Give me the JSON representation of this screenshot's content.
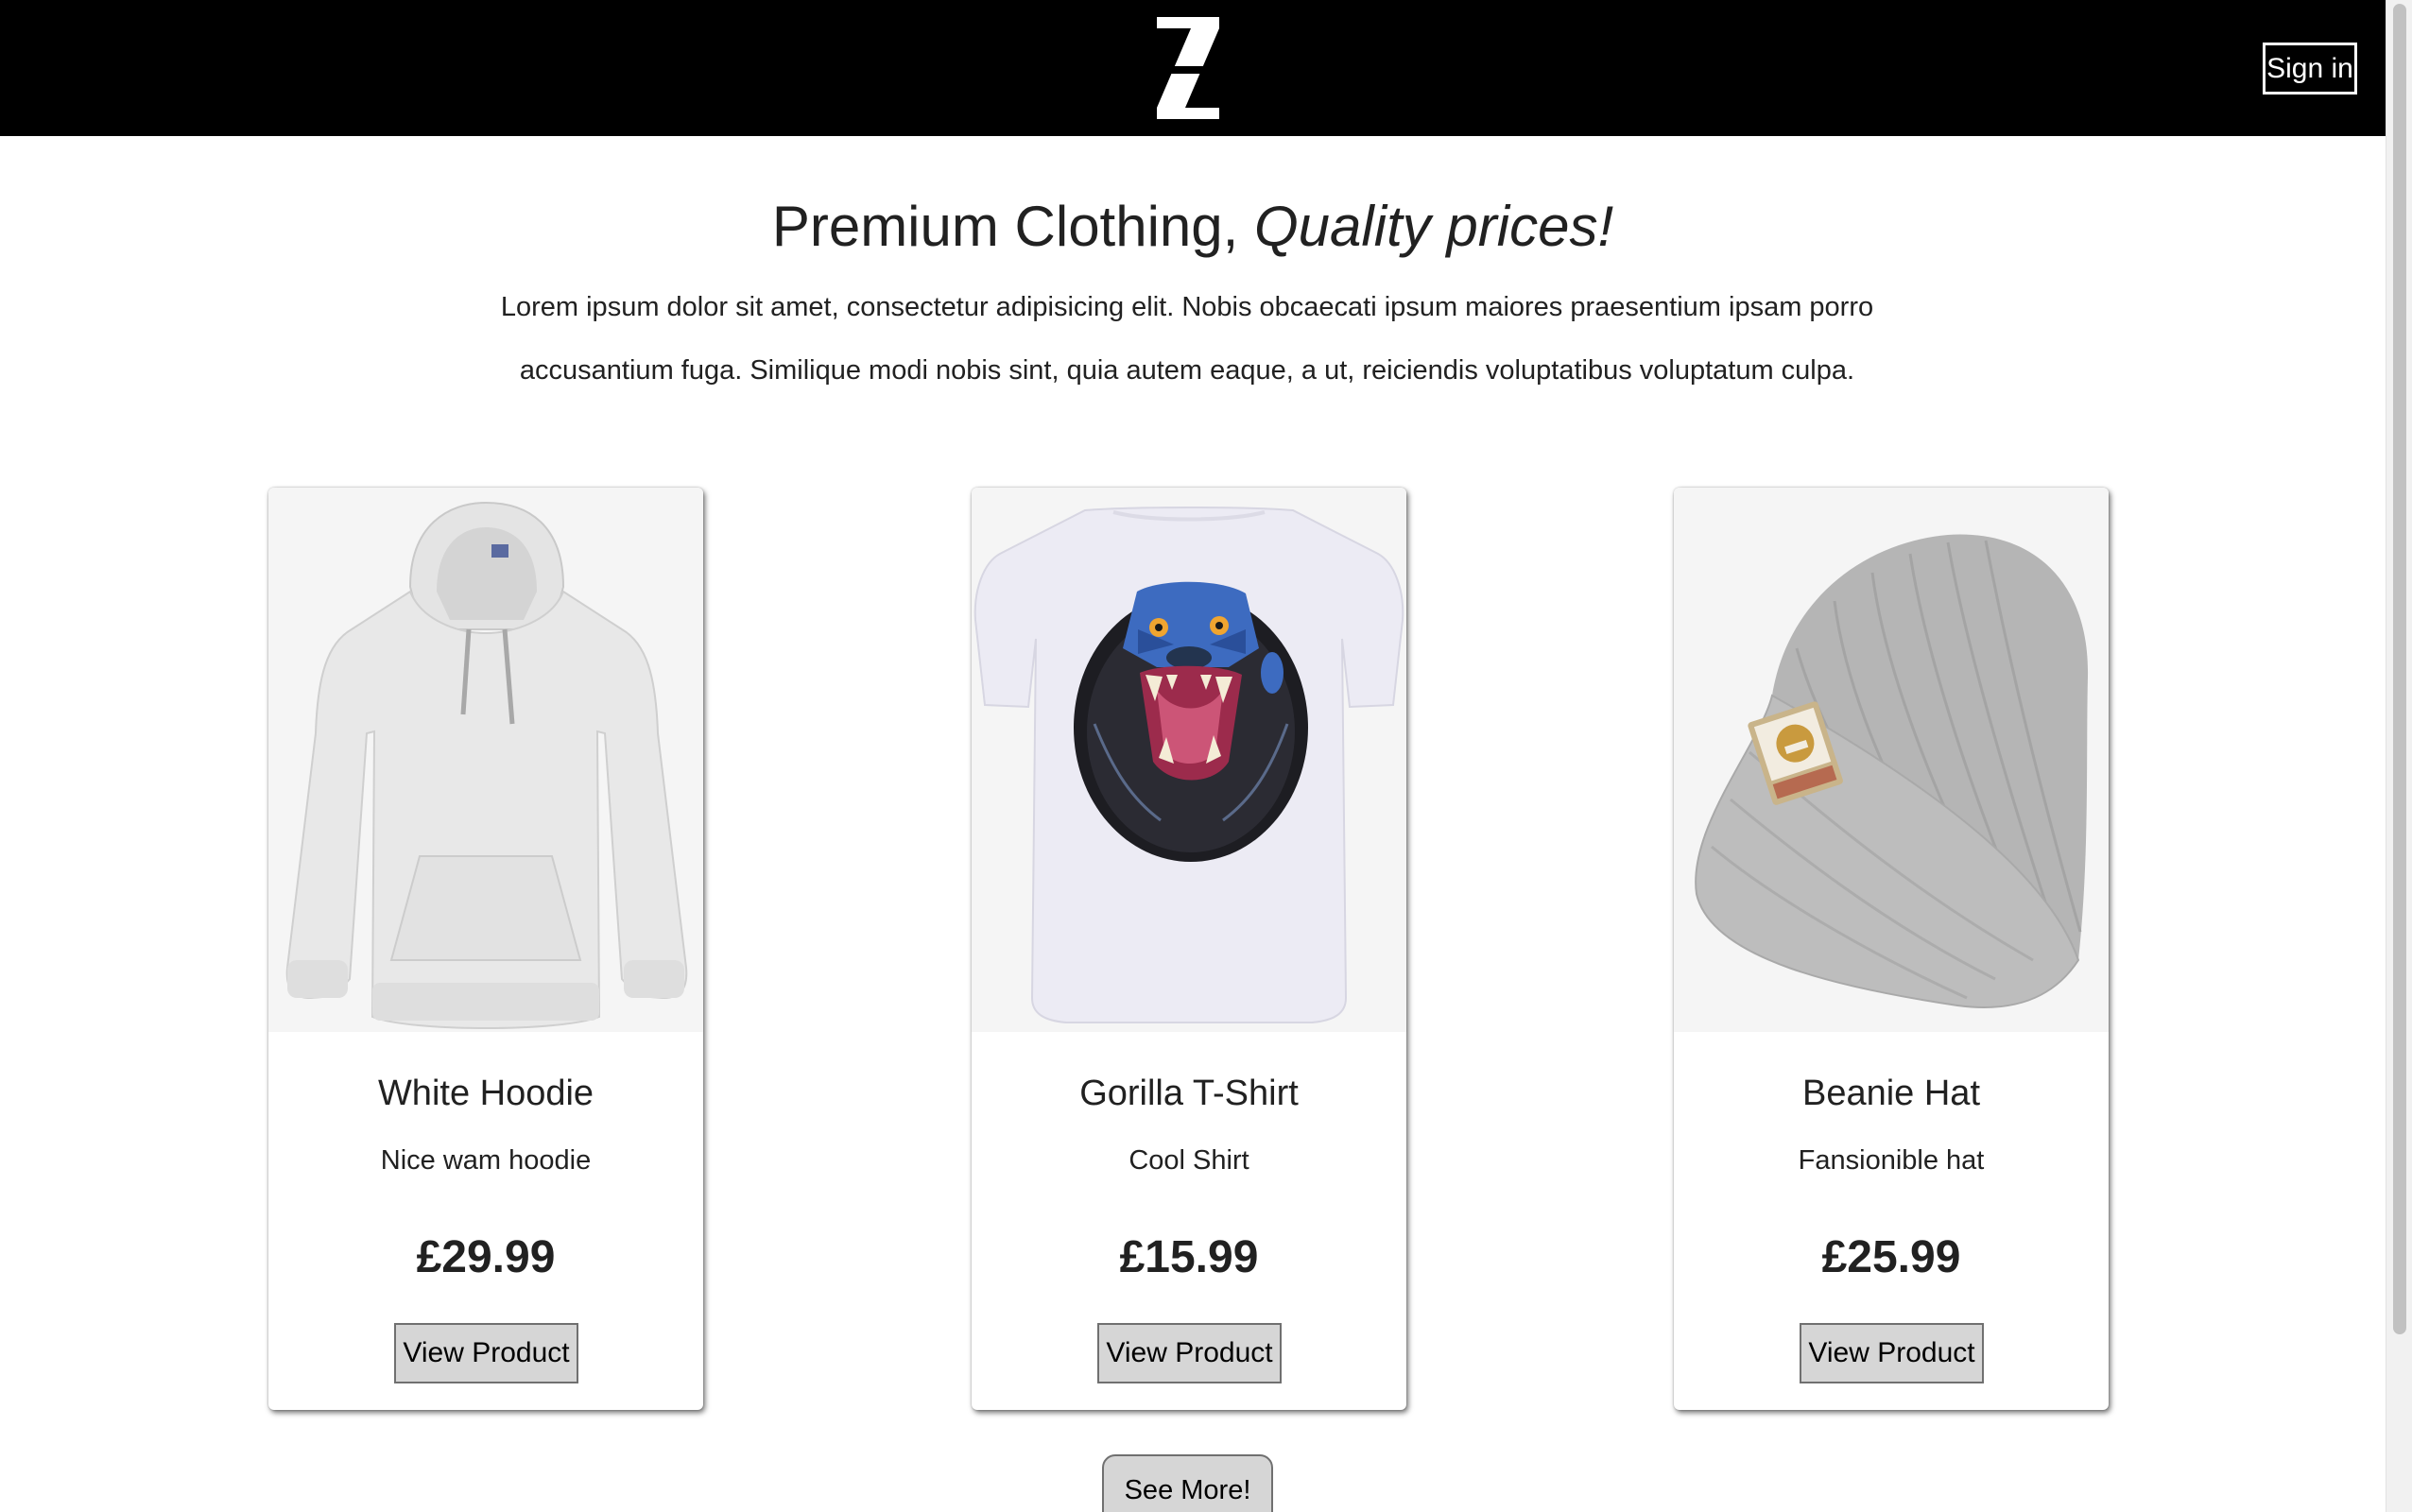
{
  "header": {
    "logo_icon": "z-logo-icon",
    "sign_in_label": "Sign in"
  },
  "hero": {
    "title_main": "Premium Clothing,",
    "title_emphasis": "Quality prices!",
    "description": "Lorem ipsum dolor sit amet, consectetur adipisicing elit. Nobis obcaecati ipsum maiores praesentium ipsam porro accusantium fuga. Similique modi nobis sint, quia autem eaque, a ut, reiciendis voluptatibus voluptatum culpa."
  },
  "products": [
    {
      "image": "white-hoodie-image",
      "name": "White Hoodie",
      "description": "Nice wam hoodie",
      "price": "£29.99",
      "button_label": "View Product"
    },
    {
      "image": "gorilla-tshirt-image",
      "name": "Gorilla T-Shirt",
      "description": "Cool Shirt",
      "price": "£15.99",
      "button_label": "View Product"
    },
    {
      "image": "beanie-hat-image",
      "name": "Beanie Hat",
      "description": "Fansionible hat",
      "price": "£25.99",
      "button_label": "View Product"
    }
  ],
  "see_more_label": "See More!",
  "colors": {
    "header_bg": "#000000",
    "header_text": "#ffffff",
    "button_bg": "#d6d6d6",
    "text": "#212121",
    "image_bg": "#f5f5f5"
  }
}
